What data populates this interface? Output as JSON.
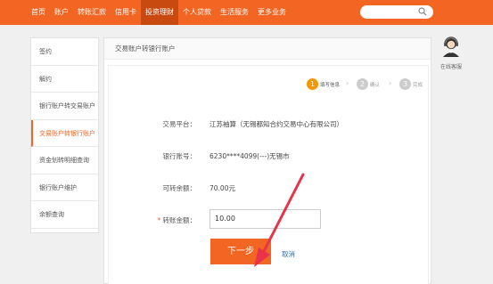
{
  "nav": {
    "items": [
      {
        "label": "首页"
      },
      {
        "label": "账户"
      },
      {
        "label": "转账汇款"
      },
      {
        "label": "信用卡"
      },
      {
        "label": "投资理财"
      },
      {
        "label": "个人贷款"
      },
      {
        "label": "生活服务"
      },
      {
        "label": "更多业务"
      }
    ],
    "active_index": 4,
    "search_placeholder": ""
  },
  "sidebar": {
    "items": [
      {
        "label": "签约"
      },
      {
        "label": "解约"
      },
      {
        "label": "银行账户转交易账户"
      },
      {
        "label": "交易账户转银行账户"
      },
      {
        "label": "资金划转明细查询"
      },
      {
        "label": "银行账户维护"
      },
      {
        "label": "余额查询"
      }
    ],
    "active_index": 3
  },
  "panel": {
    "title": "交易账户转银行账户"
  },
  "steps": [
    {
      "number": "1",
      "label": "填写信息"
    },
    {
      "number": "2",
      "label": "确认"
    },
    {
      "number": "3",
      "label": "完成"
    }
  ],
  "form": {
    "platform_label": "交易平台：",
    "platform_value": "江苏袖算（无锡都知合约交易中心有限公司）",
    "account_label": "银行账号：",
    "account_value": "6230****4099(---)无锡市",
    "balance_label": "可转余额：",
    "balance_value": "70.00元",
    "amount_required_mark": "*",
    "amount_label": "转账金额：",
    "amount_value": "10.00"
  },
  "buttons": {
    "next_label": "下一步",
    "cancel_label": "取消"
  },
  "service": {
    "label": "在线客服"
  },
  "colors": {
    "brand": "#f26522",
    "nav_active": "#c94a10",
    "link": "#2f6fb3",
    "step_active": "#f39800",
    "step_inactive": "#cccccc",
    "arrow": "#e8334a"
  }
}
